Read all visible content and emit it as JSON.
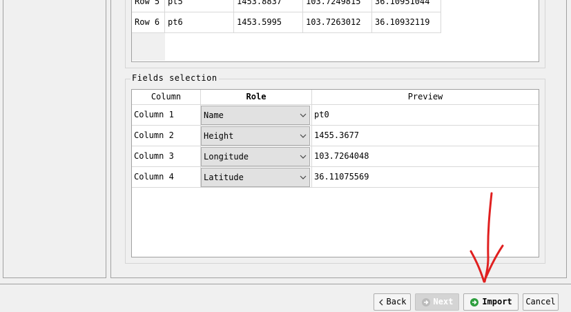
{
  "preview_table": {
    "rows": [
      {
        "header": "Row 5",
        "cells": [
          "pt5",
          "1453.8837",
          "103.7249815",
          "36.10951044"
        ]
      },
      {
        "header": "Row 6",
        "cells": [
          "pt6",
          "1453.5995",
          "103.7263012",
          "36.10932119"
        ]
      }
    ]
  },
  "fields_selection": {
    "legend": "Fields selection",
    "headers": {
      "column": "Column",
      "role": "Role",
      "preview": "Preview"
    },
    "rows": [
      {
        "column": "Column 1",
        "role": "Name",
        "preview": "pt0"
      },
      {
        "column": "Column 2",
        "role": "Height",
        "preview": "1455.3677"
      },
      {
        "column": "Column 3",
        "role": "Longitude",
        "preview": "103.7264048"
      },
      {
        "column": "Column 4",
        "role": "Latitude",
        "preview": "36.11075569"
      }
    ]
  },
  "buttons": {
    "back": "Back",
    "next": "Next",
    "import": "Import",
    "cancel": "Cancel"
  },
  "colors": {
    "annotation_arrow": "#e02020",
    "import_icon": "#2e9e3e",
    "next_icon": "#ffffff"
  },
  "icons": {
    "back": "chevron-left-icon",
    "next": "arrow-right-circle-icon",
    "import": "arrow-right-circle-icon",
    "role_dropdown": "chevron-down-icon"
  }
}
